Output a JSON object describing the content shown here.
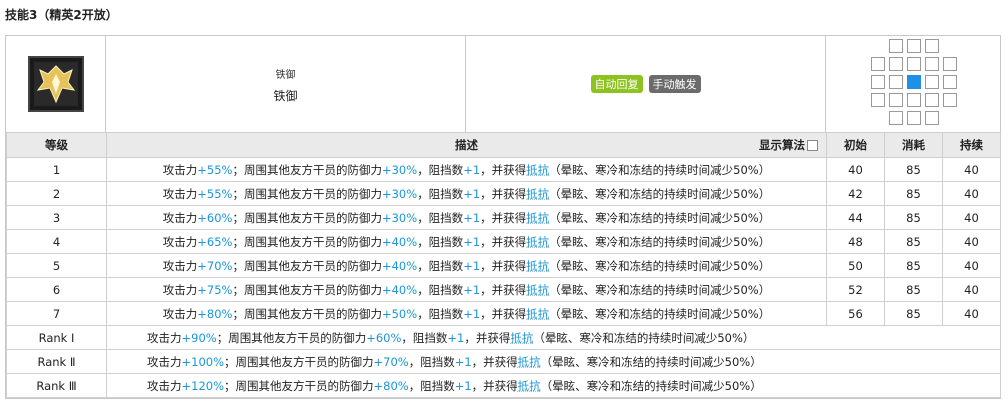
{
  "heading": "技能3（精英2开放）",
  "skill": {
    "name_small": "铁御",
    "name": "铁御",
    "tag_recovery": "自动回复",
    "tag_trigger": "手动触发"
  },
  "colors": {
    "accent": "#1a95d6",
    "range_active": "#1e90e6",
    "tag_green": "#8dc21f",
    "tag_gray": "#6b6b6b"
  },
  "table": {
    "headers": {
      "level": "等级",
      "desc": "描述",
      "algo": "显示算法",
      "init": "初始",
      "cost": "消耗",
      "duration": "持续"
    },
    "desc_parts": {
      "atk": "攻击力",
      "sep": "；周围其他友方干员的防御力",
      "block": "，阻挡数",
      "block_val": "+1",
      "gain": "，并获得",
      "keyword": "抵抗",
      "tail": "（晕眩、寒冷和冻结的持续时间减少50%）"
    },
    "rows": [
      {
        "level": "1",
        "atk": "+55%",
        "def": "+30%",
        "init": "40",
        "cost": "85",
        "dur": "40"
      },
      {
        "level": "2",
        "atk": "+55%",
        "def": "+30%",
        "init": "42",
        "cost": "85",
        "dur": "40"
      },
      {
        "level": "3",
        "atk": "+60%",
        "def": "+30%",
        "init": "44",
        "cost": "85",
        "dur": "40"
      },
      {
        "level": "4",
        "atk": "+65%",
        "def": "+40%",
        "init": "48",
        "cost": "85",
        "dur": "40"
      },
      {
        "level": "5",
        "atk": "+70%",
        "def": "+40%",
        "init": "50",
        "cost": "85",
        "dur": "40"
      },
      {
        "level": "6",
        "atk": "+75%",
        "def": "+40%",
        "init": "52",
        "cost": "85",
        "dur": "40"
      },
      {
        "level": "7",
        "atk": "+80%",
        "def": "+50%",
        "init": "56",
        "cost": "85",
        "dur": "40"
      }
    ],
    "ranks": [
      {
        "level": "Rank Ⅰ",
        "atk": "+90%",
        "def": "+60%"
      },
      {
        "level": "Rank Ⅱ",
        "atk": "+100%",
        "def": "+70%"
      },
      {
        "level": "Rank Ⅲ",
        "atk": "+120%",
        "def": "+80%"
      }
    ]
  }
}
